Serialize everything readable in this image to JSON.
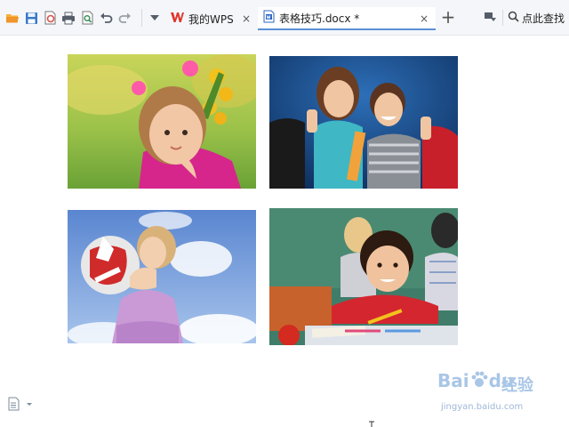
{
  "toolbar": {
    "quick_access": [
      {
        "name": "open-folder-icon",
        "color": "#f0a030"
      },
      {
        "name": "save-icon",
        "color": "#3a78c9"
      },
      {
        "name": "export-pdf-icon",
        "color": "#d9534f"
      },
      {
        "name": "print-icon",
        "color": "#555d6b"
      },
      {
        "name": "print-preview-icon",
        "color": "#3a8f5a"
      },
      {
        "name": "undo-icon",
        "color": "#555d6b"
      },
      {
        "name": "redo-icon",
        "color": "#9aa0a8"
      },
      {
        "name": "customize-dropdown-icon",
        "color": "#555d6b"
      }
    ]
  },
  "tabs": [
    {
      "label": "我的WPS",
      "icon": "wps-logo-icon",
      "active": false,
      "close": "×"
    },
    {
      "label": "表格技巧.docx *",
      "icon": "word-doc-icon",
      "active": true,
      "close": "×"
    }
  ],
  "add_tab": "+",
  "search": {
    "label": "点此查找"
  },
  "document": {
    "photos": [
      {
        "name": "photo-girl-with-flowers"
      },
      {
        "name": "photo-kids-thumbs-up"
      },
      {
        "name": "photo-girl-with-ball"
      },
      {
        "name": "photo-boy-in-classroom"
      }
    ]
  },
  "watermark": {
    "logo": "Bai",
    "logo_suffix": "du",
    "cn": "经验",
    "url": "jingyan.baidu.com"
  },
  "colors": {
    "accent": "#5b8fd6",
    "wps_red": "#e0352b",
    "doc_blue": "#2b65c5"
  }
}
